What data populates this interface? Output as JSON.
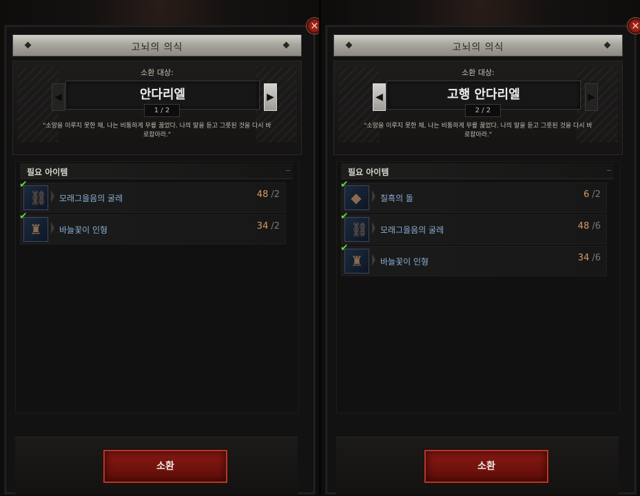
{
  "panels": [
    {
      "title": "고뇌의 의식",
      "summon_target_label": "소환 대상:",
      "target_name": "안다리엘",
      "page_indicator": "1 / 2",
      "quote": "\"소망을 이루지 못한 채, 나는 비통하게 무릎 꿇었다. 나의 말을 듣고 그릇된 것을 다시 바로잡아라.\"",
      "required_items_label": "필요 아이템",
      "items": [
        {
          "name": "모래그을음의 굴레",
          "have": "48",
          "need": "/2"
        },
        {
          "name": "바늘꽃이 인형",
          "have": "34",
          "need": "/2"
        }
      ],
      "summon_button": "소환"
    },
    {
      "title": "고뇌의 의식",
      "summon_target_label": "소환 대상:",
      "target_name": "고행 안다리엘",
      "page_indicator": "2 / 2",
      "quote": "\"소망을 이루지 못한 채, 나는 비통하게 무릎 꿇었다. 나의 말을 듣고 그릇된 것을 다시 바로잡아라.\"",
      "required_items_label": "필요 아이템",
      "items": [
        {
          "name": "칠흑의 돌",
          "have": "6",
          "need": "/2"
        },
        {
          "name": "모래그을음의 굴레",
          "have": "48",
          "need": "/6"
        },
        {
          "name": "바늘꽃이 인형",
          "have": "34",
          "need": "/6"
        }
      ],
      "summon_button": "소환"
    }
  ],
  "icons": {
    "check": "✔",
    "close": "×",
    "arrow_left": "◀",
    "arrow_right": "▶"
  },
  "colors": {
    "item_name": "#8ab0d8",
    "item_have": "#d89a62",
    "check": "#69d43b",
    "summon_button": "#7a1510"
  }
}
